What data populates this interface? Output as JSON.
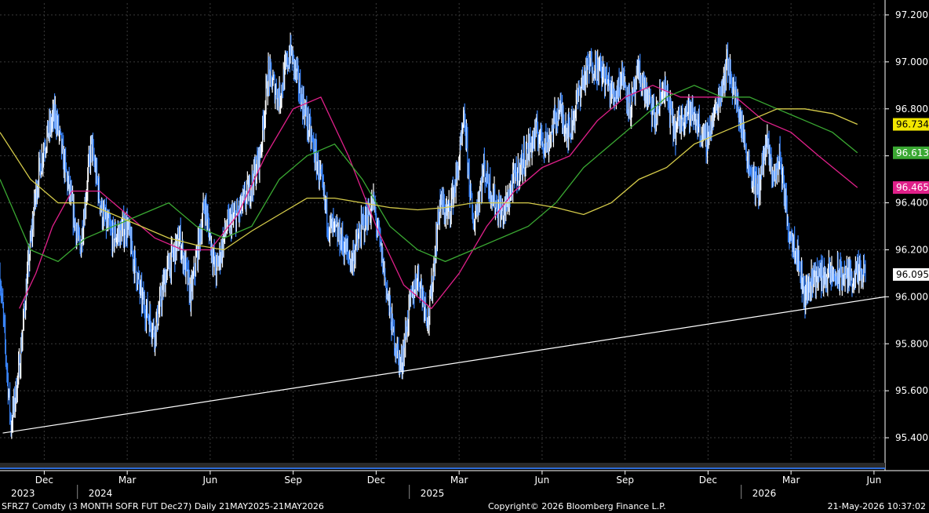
{
  "colors": {
    "background": "#000000",
    "price_bars": "#ffffff",
    "price_bars_down": "#3a86ff",
    "ma_short": "#e0208a",
    "ma_mid": "#3aa832",
    "ma_long": "#d6cc4a",
    "grid": "#3a3a3a",
    "trendline": "#ffffff"
  },
  "chart_data": {
    "type": "line",
    "title": "",
    "xlabel": "",
    "ylabel": "",
    "ylim": [
      95.3,
      97.25
    ],
    "grid": true,
    "y_axis_position": "right",
    "y_ticks": [
      "97.200",
      "97.000",
      "96.800",
      "96.600",
      "96.400",
      "96.200",
      "96.000",
      "95.800",
      "95.600",
      "95.400"
    ],
    "y_tick_values": [
      97.2,
      97.0,
      96.8,
      96.6,
      96.4,
      96.2,
      96.0,
      95.8,
      95.6,
      95.4
    ],
    "x_month_labels": [
      {
        "label": "Dec",
        "t": 0
      },
      {
        "label": "Mar",
        "t": 3
      },
      {
        "label": "Jun",
        "t": 6
      },
      {
        "label": "Sep",
        "t": 9
      },
      {
        "label": "Dec",
        "t": 12
      },
      {
        "label": "Mar",
        "t": 15
      },
      {
        "label": "Jun",
        "t": 18
      },
      {
        "label": "Sep",
        "t": 21
      },
      {
        "label": "Dec",
        "t": 24
      },
      {
        "label": "Mar",
        "t": 27
      },
      {
        "label": "Jun",
        "t": 30
      }
    ],
    "x_year_labels": [
      {
        "label": "2023",
        "t": -1.8
      },
      {
        "label": "2024",
        "t": 1.2
      },
      {
        "label": "2025",
        "t": 13.2
      },
      {
        "label": "2026",
        "t": 25.2
      }
    ],
    "x_range_months": [
      -1.6,
      30.4
    ],
    "price_series": {
      "name": "",
      "t": [
        -1.6,
        -1.2,
        -0.9,
        -0.6,
        -0.3,
        0,
        0.4,
        0.9,
        1.3,
        1.7,
        2.1,
        2.5,
        3,
        3.5,
        4,
        4.4,
        4.9,
        5.3,
        5.8,
        6.2,
        6.6,
        7,
        7.4,
        7.8,
        8.1,
        8.5,
        8.9,
        9.2,
        9.5,
        9.9,
        10.3,
        10.7,
        11.1,
        11.5,
        11.9,
        12.3,
        12.6,
        12.9,
        13.2,
        13.5,
        13.9,
        14.3,
        14.6,
        14.9,
        15.2,
        15.5,
        15.9,
        16.3,
        16.6,
        17,
        17.4,
        17.8,
        18.2,
        18.6,
        19,
        19.4,
        19.8,
        20.2,
        20.6,
        20.9,
        21.2,
        21.5,
        21.8,
        22.1,
        22.4,
        22.8,
        23.2,
        23.6,
        23.9,
        24.3,
        24.7,
        25.1,
        25.5,
        25.8,
        26.1,
        26.4,
        26.6,
        26.9,
        27.2,
        27.5,
        27.8,
        28.1,
        28.4,
        28.7,
        29,
        29.3,
        29.5,
        29.7
      ],
      "values": [
        96.1,
        95.45,
        95.7,
        96.1,
        96.45,
        96.65,
        96.78,
        96.45,
        96.2,
        96.65,
        96.35,
        96.25,
        96.3,
        96.0,
        95.85,
        96.1,
        96.25,
        96.0,
        96.4,
        96.1,
        96.3,
        96.35,
        96.45,
        96.6,
        96.95,
        96.85,
        97.05,
        96.9,
        96.75,
        96.55,
        96.3,
        96.25,
        96.15,
        96.3,
        96.4,
        96.1,
        95.85,
        95.7,
        95.95,
        96.1,
        95.9,
        96.4,
        96.35,
        96.5,
        96.75,
        96.3,
        96.55,
        96.4,
        96.35,
        96.5,
        96.6,
        96.7,
        96.65,
        96.8,
        96.7,
        96.9,
        97.0,
        96.95,
        96.85,
        96.95,
        96.8,
        96.95,
        96.85,
        96.75,
        96.9,
        96.7,
        96.8,
        96.75,
        96.65,
        96.8,
        97.0,
        96.8,
        96.55,
        96.45,
        96.65,
        96.5,
        96.6,
        96.3,
        96.2,
        96.0,
        96.09,
        96.09,
        96.09,
        96.09,
        96.09,
        96.09,
        96.09,
        96.09
      ]
    },
    "ma_series": [
      {
        "name": "",
        "color_key": "ma_short",
        "t": [
          -0.9,
          -0.3,
          0.3,
          1,
          2,
          3,
          4,
          5,
          6,
          7,
          8,
          9,
          10,
          11,
          12,
          13,
          14,
          15,
          16,
          17,
          18,
          19,
          20,
          21,
          22,
          23,
          24,
          25,
          26,
          27,
          28,
          29.4
        ],
        "values": [
          95.95,
          96.1,
          96.3,
          96.45,
          96.45,
          96.35,
          96.25,
          96.2,
          96.2,
          96.35,
          96.6,
          96.8,
          96.85,
          96.6,
          96.3,
          96.05,
          95.95,
          96.1,
          96.3,
          96.45,
          96.55,
          96.6,
          96.75,
          96.85,
          96.9,
          96.85,
          96.85,
          96.85,
          96.75,
          96.7,
          96.6,
          96.465
        ]
      },
      {
        "name": "",
        "color_key": "ma_mid",
        "t": [
          -1.6,
          -0.5,
          0.5,
          1.5,
          2.5,
          3.5,
          4.5,
          5.5,
          6.5,
          7.5,
          8.5,
          9.5,
          10.5,
          11.5,
          12.5,
          13.5,
          14.5,
          15.5,
          16.5,
          17.5,
          18.5,
          19.5,
          20.5,
          21.5,
          22.5,
          23.5,
          24.5,
          25.5,
          26.5,
          27.5,
          28.5,
          29.4
        ],
        "values": [
          96.5,
          96.2,
          96.15,
          96.25,
          96.3,
          96.35,
          96.4,
          96.3,
          96.25,
          96.3,
          96.5,
          96.6,
          96.65,
          96.5,
          96.3,
          96.2,
          96.15,
          96.2,
          96.25,
          96.3,
          96.4,
          96.55,
          96.65,
          96.75,
          96.85,
          96.9,
          96.85,
          96.85,
          96.8,
          96.75,
          96.7,
          96.613
        ]
      },
      {
        "name": "",
        "color_key": "ma_long",
        "t": [
          -1.6,
          -0.5,
          0.5,
          1.5,
          2.5,
          3.5,
          4.5,
          5.5,
          6.5,
          7.5,
          8.5,
          9.5,
          10.5,
          11.5,
          12.5,
          13.5,
          14.5,
          15.5,
          16.5,
          17.5,
          18.5,
          19.5,
          20.5,
          21.5,
          22.5,
          23.5,
          24.5,
          25.5,
          26.5,
          27.5,
          28.5,
          29.4
        ],
        "values": [
          96.7,
          96.5,
          96.4,
          96.4,
          96.35,
          96.3,
          96.25,
          96.22,
          96.2,
          96.28,
          96.35,
          96.42,
          96.42,
          96.4,
          96.38,
          96.37,
          96.38,
          96.4,
          96.4,
          96.4,
          96.38,
          96.35,
          96.4,
          96.5,
          96.55,
          96.65,
          96.7,
          96.75,
          96.8,
          96.8,
          96.78,
          96.734
        ]
      }
    ],
    "trendline": {
      "t": [
        -1.5,
        30.4
      ],
      "values": [
        95.42,
        96.0
      ]
    },
    "last_value_labels": [
      {
        "text": "96.734",
        "value": 96.734,
        "bg": "#f2e600",
        "fg": "#000000"
      },
      {
        "text": "96.613",
        "value": 96.613,
        "bg": "#3aa832",
        "fg": "#ffffff"
      },
      {
        "text": "96.465",
        "value": 96.465,
        "bg": "#e0208a",
        "fg": "#ffffff"
      },
      {
        "text": "96.095",
        "value": 96.095,
        "bg": "#ffffff",
        "fg": "#000000"
      }
    ]
  },
  "footer": {
    "left": "SFRZ7 Comdty (3 MONTH SOFR FUT  Dec27) Daily 21MAY2025-21MAY2026",
    "center": "Copyright© 2026 Bloomberg Finance L.P.",
    "right": "21-May-2026 10:37:02"
  }
}
